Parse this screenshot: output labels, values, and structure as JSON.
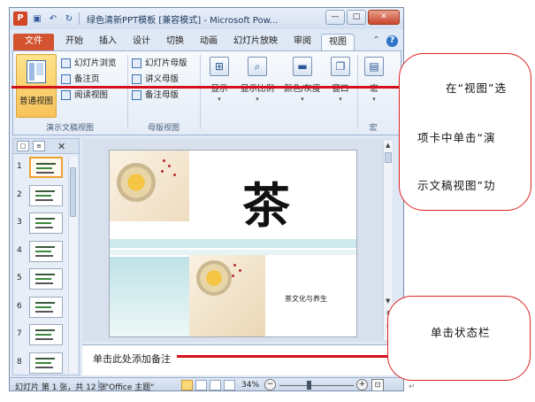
{
  "window": {
    "title": "绿色清新PPT模板 [兼容模式] - Microsoft Pow...",
    "controls": {
      "minimize": "—",
      "maximize": "□",
      "close": "✕"
    }
  },
  "quick_access": {
    "app_icon": "P",
    "save_icon": "save-icon",
    "undo_icon": "undo-icon",
    "redo_icon": "redo-icon"
  },
  "tabs": [
    {
      "label": "文件"
    },
    {
      "label": "开始"
    },
    {
      "label": "插入"
    },
    {
      "label": "设计"
    },
    {
      "label": "切换"
    },
    {
      "label": "动画"
    },
    {
      "label": "幻灯片放映"
    },
    {
      "label": "审阅"
    },
    {
      "label": "视图"
    }
  ],
  "tab_icons": {
    "minimize_ribbon": "⌃",
    "help": "?"
  },
  "ribbon": {
    "normal_view": "普通视图",
    "slide_sorter": "幻灯片浏览",
    "notes_page": "备注页",
    "reading_view": "阅读视图",
    "slide_master": "幻灯片母版",
    "handout_master": "讲义母版",
    "notes_master": "备注母版",
    "show": "显示",
    "zoom": "显示比例",
    "color_gray": "颜色/灰度",
    "window": "窗口",
    "macros": "宏",
    "groups": {
      "presentation_views": "演示文稿视图",
      "master_views": "母版视图",
      "macros": "宏"
    }
  },
  "slide_panel": {
    "tab_slides_icon": "□",
    "tab_outline_icon": "≡",
    "close": "✕",
    "numbers": [
      "1",
      "2",
      "3",
      "4",
      "5",
      "6",
      "7",
      "8"
    ],
    "selected_index": 1
  },
  "slide": {
    "big_char": "茶",
    "subtitle": "茶文化与养生"
  },
  "notes": {
    "placeholder": "单击此处添加备注"
  },
  "status_bar": {
    "slide_info": "幻灯片 第 1 张，共 12 张",
    "theme": "\"Office 主题\"",
    "zoom_percent": "34%",
    "zoom_out": "−",
    "zoom_in": "+",
    "zoom_level": 0.34
  },
  "annotations": {
    "callout_1_lines": [
      "在“视图”选",
      "项卡中单击“演",
      "示文稿视图”功"
    ],
    "callout_2": "单击状态栏",
    "return_mark": "↵"
  },
  "colors": {
    "file_tab": "#d35230",
    "annotation_red": "#d4101a",
    "selected_button": "#fbd97a"
  }
}
